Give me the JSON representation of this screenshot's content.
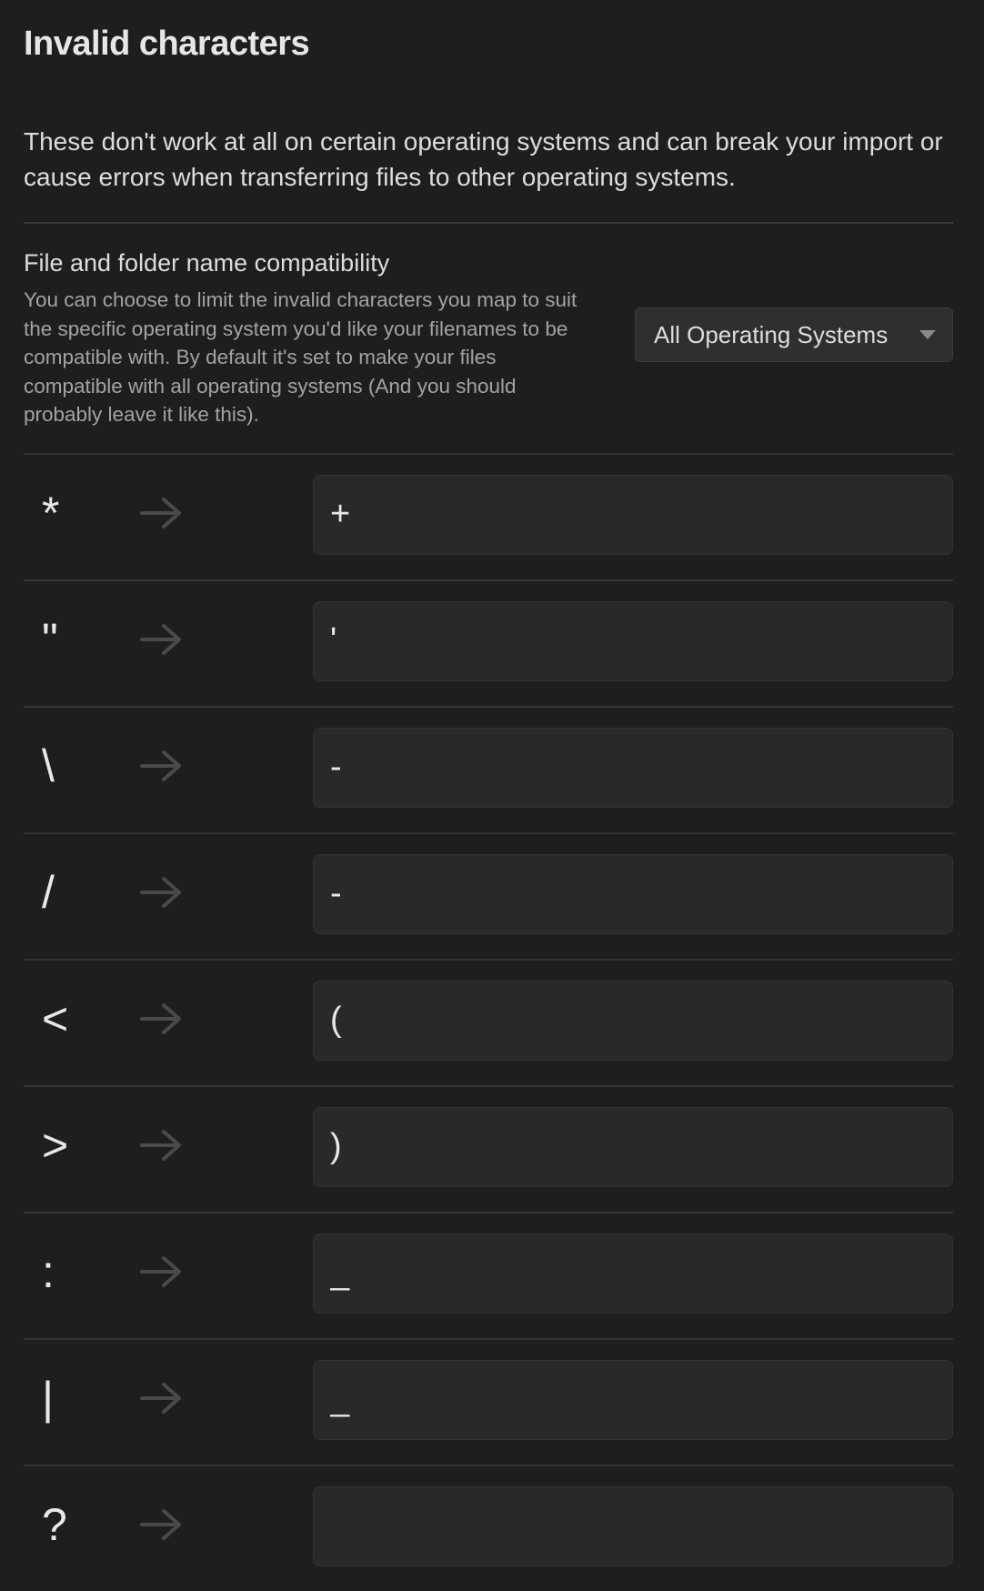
{
  "section": {
    "title": "Invalid characters",
    "description": "These don't work at all on certain operating systems and can break your import or cause errors when transferring files to other operating systems."
  },
  "compat": {
    "name": "File and folder name compatibility",
    "description": "You can choose to limit the invalid characters you map to suit the specific operating system you'd like your filenames to be compatible with. By default it's set to make your files compatible with all operating systems (And you should probably leave it like this).",
    "selected": "All Operating Systems"
  },
  "mappings": [
    {
      "char": "*",
      "value": "+"
    },
    {
      "char": "\"",
      "value": "'"
    },
    {
      "char": "\\",
      "value": "-"
    },
    {
      "char": "/",
      "value": "-"
    },
    {
      "char": "<",
      "value": "("
    },
    {
      "char": ">",
      "value": ")"
    },
    {
      "char": ":",
      "value": "_"
    },
    {
      "char": "|",
      "value": "_"
    },
    {
      "char": "?",
      "value": ""
    }
  ],
  "icons": {
    "arrow": "arrow-right-icon",
    "caret": "chevron-down-icon"
  }
}
